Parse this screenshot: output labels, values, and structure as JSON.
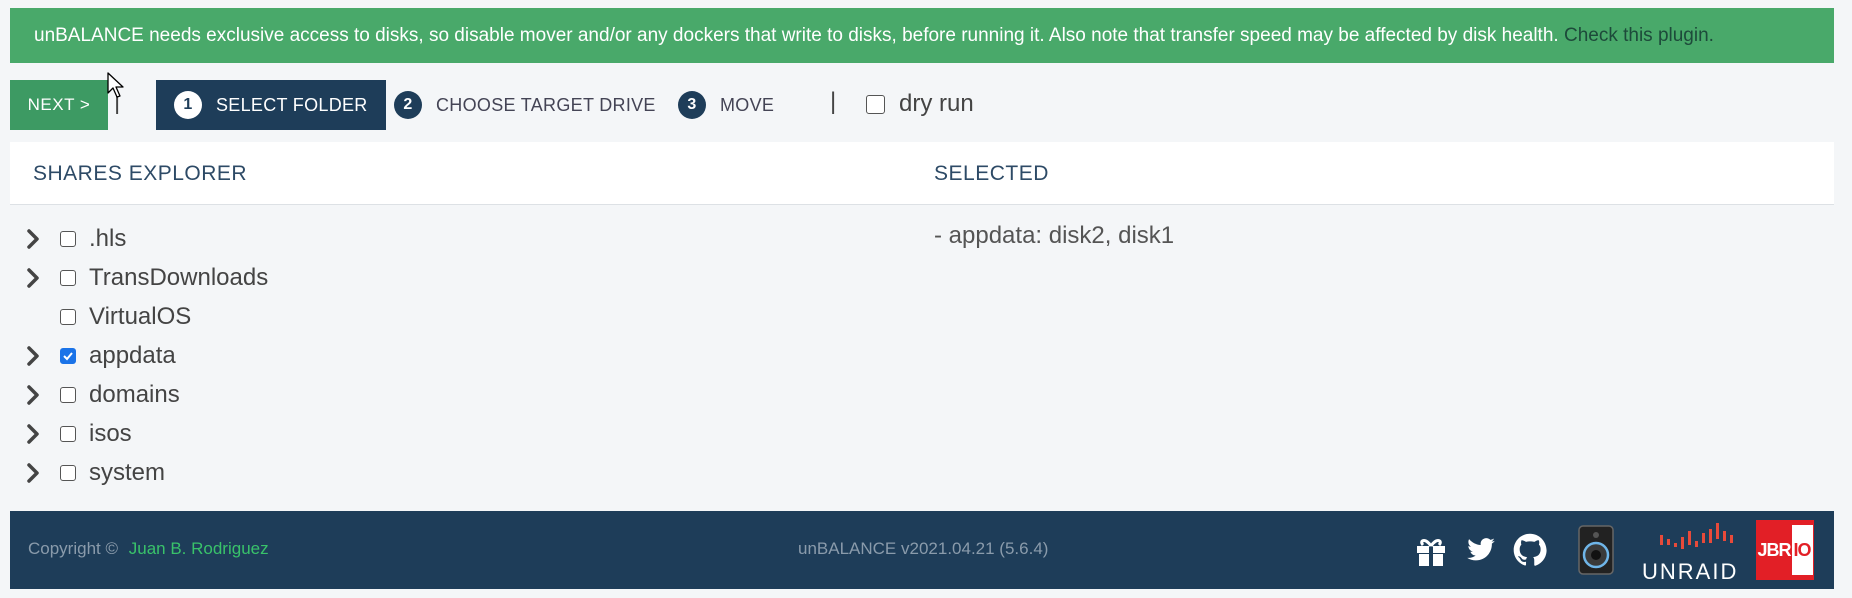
{
  "banner": {
    "message": "unBALANCE needs exclusive access to disks, so disable mover and/or any dockers that write to disks, before running it. Also note that transfer speed may be affected by disk health.",
    "link_text": "Check this plugin."
  },
  "toolbar": {
    "next_label": "NEXT >",
    "separator": "|",
    "steps": [
      {
        "number": "1",
        "label": "SELECT FOLDER",
        "active": true
      },
      {
        "number": "2",
        "label": "CHOOSE TARGET DRIVE",
        "active": false
      },
      {
        "number": "3",
        "label": "MOVE",
        "active": false
      }
    ],
    "dry_run_label": "dry run",
    "dry_run_checked": false
  },
  "shares_explorer": {
    "title": "SHARES EXPLORER",
    "items": [
      {
        "name": ".hls",
        "expandable": true,
        "checked": false
      },
      {
        "name": "TransDownloads",
        "expandable": true,
        "checked": false
      },
      {
        "name": "VirtualOS",
        "expandable": false,
        "checked": false
      },
      {
        "name": "appdata",
        "expandable": true,
        "checked": true
      },
      {
        "name": "domains",
        "expandable": true,
        "checked": false
      },
      {
        "name": "isos",
        "expandable": true,
        "checked": false
      },
      {
        "name": "system",
        "expandable": true,
        "checked": false
      }
    ]
  },
  "selected": {
    "title": "SELECTED",
    "items": [
      "- appdata: disk2, disk1"
    ]
  },
  "footer": {
    "copyright_label": "Copyright ©",
    "author": "Juan B. Rodriguez",
    "version": "unBALANCE v2021.04.21 (5.6.4)",
    "icons": [
      "gift-icon",
      "twitter-icon",
      "github-icon",
      "speaker-icon",
      "unraid-logo",
      "jbrio-logo"
    ],
    "unraid_text": "UNRAID",
    "jbrio_text": "JBR",
    "jbrio_io": "IO"
  },
  "colors": {
    "banner_green": "#49a96a",
    "next_green": "#3d9a63",
    "navy": "#1e3d59",
    "link_green": "#39c26a",
    "checkbox_blue": "#1a73e8",
    "unraid_red": "#e84a3a",
    "jbrio_red": "#e21f26"
  }
}
